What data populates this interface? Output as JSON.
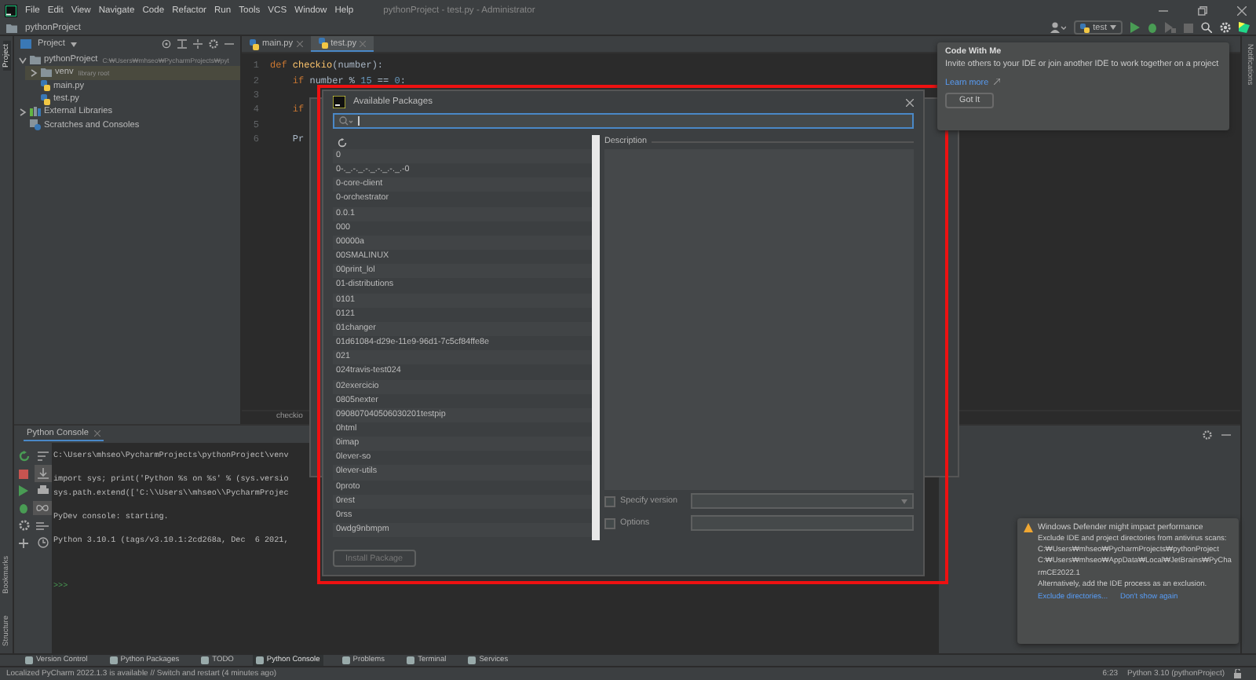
{
  "title_bar": {
    "menu": [
      "File",
      "Edit",
      "View",
      "Navigate",
      "Code",
      "Refactor",
      "Run",
      "Tools",
      "VCS",
      "Window",
      "Help"
    ],
    "title": "pythonProject - test.py - Administrator"
  },
  "nav_bar": {
    "breadcrumb": "pythonProject",
    "run_config": "test"
  },
  "left_stripe": {
    "top": [
      {
        "label": "Project",
        "selected": true
      }
    ],
    "bottom": [
      {
        "label": "Bookmarks",
        "selected": false
      },
      {
        "label": "Structure",
        "selected": false
      }
    ]
  },
  "right_stripe": [
    {
      "label": "Notifications",
      "selected": false
    }
  ],
  "project_panel": {
    "title": "Project",
    "tree": [
      {
        "label": "pythonProject",
        "hint": "C:₩Users₩mhseo₩PycharmProjects₩pyt",
        "kind": "folder",
        "expanded": true,
        "selected": false,
        "children": [
          {
            "label": "venv",
            "hint": "library root",
            "kind": "folder",
            "expanded": false,
            "selected": true
          },
          {
            "label": "main.py",
            "kind": "python",
            "selected": false
          },
          {
            "label": "test.py",
            "kind": "python",
            "selected": false
          }
        ]
      },
      {
        "label": "External Libraries",
        "kind": "library",
        "expanded": false,
        "selected": false
      },
      {
        "label": "Scratches and Consoles",
        "kind": "scratch",
        "selected": false
      }
    ]
  },
  "editor": {
    "tabs": [
      {
        "label": "main.py",
        "selected": false
      },
      {
        "label": "test.py",
        "selected": true
      }
    ],
    "lines": [
      {
        "number": "1",
        "tokens": [
          {
            "kind": "keyword",
            "text": "def "
          },
          {
            "kind": "function",
            "text": "checkio"
          },
          {
            "kind": "plain",
            "text": "(number):"
          }
        ]
      },
      {
        "number": "2",
        "tokens": [
          {
            "kind": "keyword",
            "text": "    if "
          },
          {
            "kind": "plain",
            "text": "number % "
          },
          {
            "kind": "number",
            "text": "15"
          },
          {
            "kind": "plain",
            "text": " == "
          },
          {
            "kind": "number",
            "text": "0"
          },
          {
            "kind": "plain",
            "text": ":"
          }
        ]
      },
      {
        "number": "3"
      },
      {
        "number": "4",
        "tokens": [
          {
            "kind": "keyword",
            "text": "    if"
          }
        ]
      },
      {
        "number": "5"
      },
      {
        "number": "6",
        "tokens": [
          {
            "kind": "plain",
            "text": "    Pr"
          }
        ]
      }
    ],
    "breadcrumb": "checkio"
  },
  "code_with_me": {
    "title": "Code With Me",
    "text": "Invite others to your IDE or join another IDE to work together on a project",
    "link": "Learn more",
    "button": "Got It"
  },
  "console": {
    "tab": "Python Console",
    "blocks": [
      [
        "C:\\Users\\mhseo\\PycharmProjects\\pythonProject\\venv"
      ],
      [
        "import sys; print('Python %s on %s' % (sys.versio",
        "sys.path.extend(['C:\\\\Users\\\\mhseo\\\\PycharmProjec"
      ],
      [
        "PyDev console: starting."
      ],
      [
        "Python 3.10.1 (tags/v3.10.1:2cd268a, Dec  6 2021,"
      ]
    ],
    "prompt": ">>>"
  },
  "dialog": {
    "title": "Available Packages",
    "packages": [
      "0",
      "0-._.-._.-._.-._.-._.-0",
      "0-core-client",
      "0-orchestrator",
      "0.0.1",
      "000",
      "00000a",
      "00SMALINUX",
      "00print_lol",
      "01-distributions",
      "0101",
      "0121",
      "01changer",
      "01d61084-d29e-11e9-96d1-7c5cf84ffe8e",
      "021",
      "024travis-test024",
      "02exercicio",
      "0805nexter",
      "090807040506030201testpip",
      "0html",
      "0imap",
      "0lever-so",
      "0lever-utils",
      "0proto",
      "0rest",
      "0rss",
      "0wdg9nbmpm"
    ],
    "description_label": "Description",
    "specify_version": {
      "label": "Specify version",
      "checked": false
    },
    "options": {
      "label": "Options",
      "checked": false
    },
    "install_button": {
      "label": "Install Package",
      "disabled": true
    }
  },
  "notification": {
    "title": "Windows Defender might impact performance",
    "body": [
      "Exclude IDE and project directories from antivirus scans:",
      "C:₩Users₩mhseo₩PycharmProjects₩pythonProject",
      "C:₩Users₩mhseo₩AppData₩Local₩JetBrains₩PyCharmCE2022.1",
      "Alternatively, add the IDE process as an exclusion."
    ],
    "actions": [
      "Exclude directories...",
      "Don't show again"
    ]
  },
  "tool_windows": [
    {
      "label": "Version Control",
      "selected": false
    },
    {
      "label": "Python Packages",
      "selected": false
    },
    {
      "label": "TODO",
      "selected": false
    },
    {
      "label": "Python Console",
      "selected": true
    },
    {
      "label": "Problems",
      "selected": false
    },
    {
      "label": "Terminal",
      "selected": false
    },
    {
      "label": "Services",
      "selected": false
    }
  ],
  "status_bar": {
    "message": "Localized PyCharm 2022.1.3 is available // Switch and restart (4 minutes ago)",
    "position": "6:23",
    "interpreter": "Python 3.10 (pythonProject)"
  }
}
